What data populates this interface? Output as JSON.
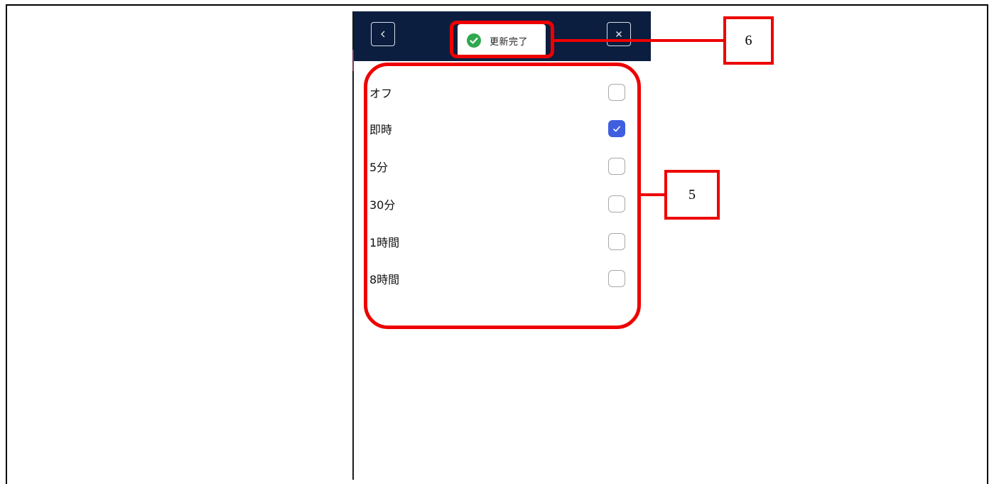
{
  "toast": {
    "text": "更新完了",
    "status_color": "#2fa84f"
  },
  "header": {
    "background": "#0b1e3f",
    "back_icon": "chevron-left-icon",
    "close_icon": "close-icon"
  },
  "options": [
    {
      "label": "オフ",
      "checked": false
    },
    {
      "label": "即時",
      "checked": true
    },
    {
      "label": "5分",
      "checked": false
    },
    {
      "label": "30分",
      "checked": false
    },
    {
      "label": "1時間",
      "checked": false
    },
    {
      "label": "8時間",
      "checked": false
    }
  ],
  "annotations": {
    "options_callout": "5",
    "toast_callout": "6",
    "color": "#ee0000"
  }
}
